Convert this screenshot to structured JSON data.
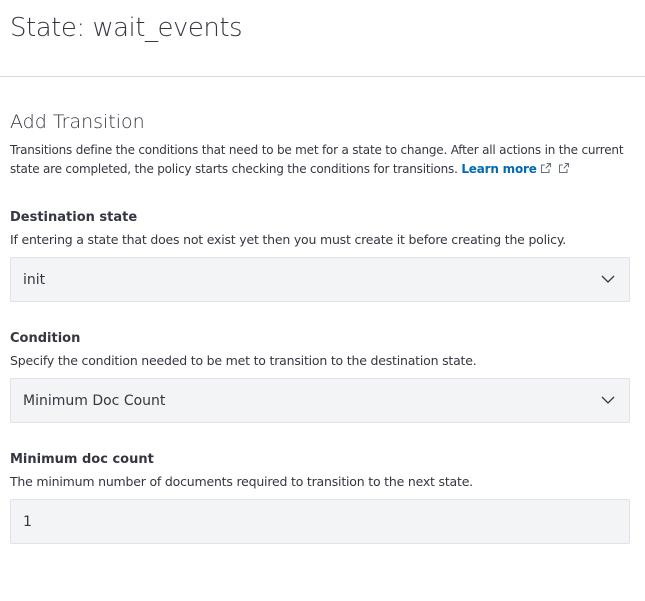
{
  "header": {
    "title": "State: wait_events"
  },
  "transition": {
    "title": "Add Transition",
    "description": "Transitions define the conditions that need to be met for a state to change. After all actions in the current state are completed, the policy starts checking the conditions for transitions.",
    "learn_more": "Learn more"
  },
  "destination": {
    "label": "Destination state",
    "help": "If entering a state that does not exist yet then you must create it before creating the policy.",
    "value": "init"
  },
  "condition": {
    "label": "Condition",
    "help": "Specify the condition needed to be met to transition to the destination state.",
    "value": "Minimum Doc Count"
  },
  "doc_count": {
    "label": "Minimum doc count",
    "help": "The minimum number of documents required to transition to the next state.",
    "value": "1"
  },
  "colors": {
    "link": "#006bb4",
    "text": "#343741",
    "control_bg": "#f3f4f6"
  }
}
